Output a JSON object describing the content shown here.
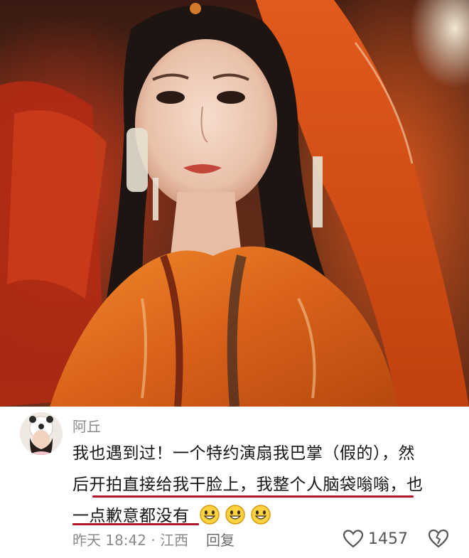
{
  "photo": {
    "description_icon": "portrait-photo"
  },
  "comment": {
    "username": "阿丘",
    "text_line1": "我也遇到过！一个特约演扇我巴掌（假的），然",
    "text_line2": "后开拍直接给我干脸上，我整个人脑袋嗡嗡，也",
    "text_line3": "一点歉意都没有",
    "emojis": [
      "grin-face-icon",
      "grin-face-icon",
      "grin-face-icon"
    ],
    "time": "昨天 18:42 · 江西",
    "reply_label": "回复",
    "like_count": "1457",
    "like_icon": "heart-outline-icon",
    "dislike_icon": "broken-heart-icon"
  },
  "colors": {
    "underline": "#b0152a",
    "text": "#161616",
    "meta": "#8a8a8a"
  }
}
